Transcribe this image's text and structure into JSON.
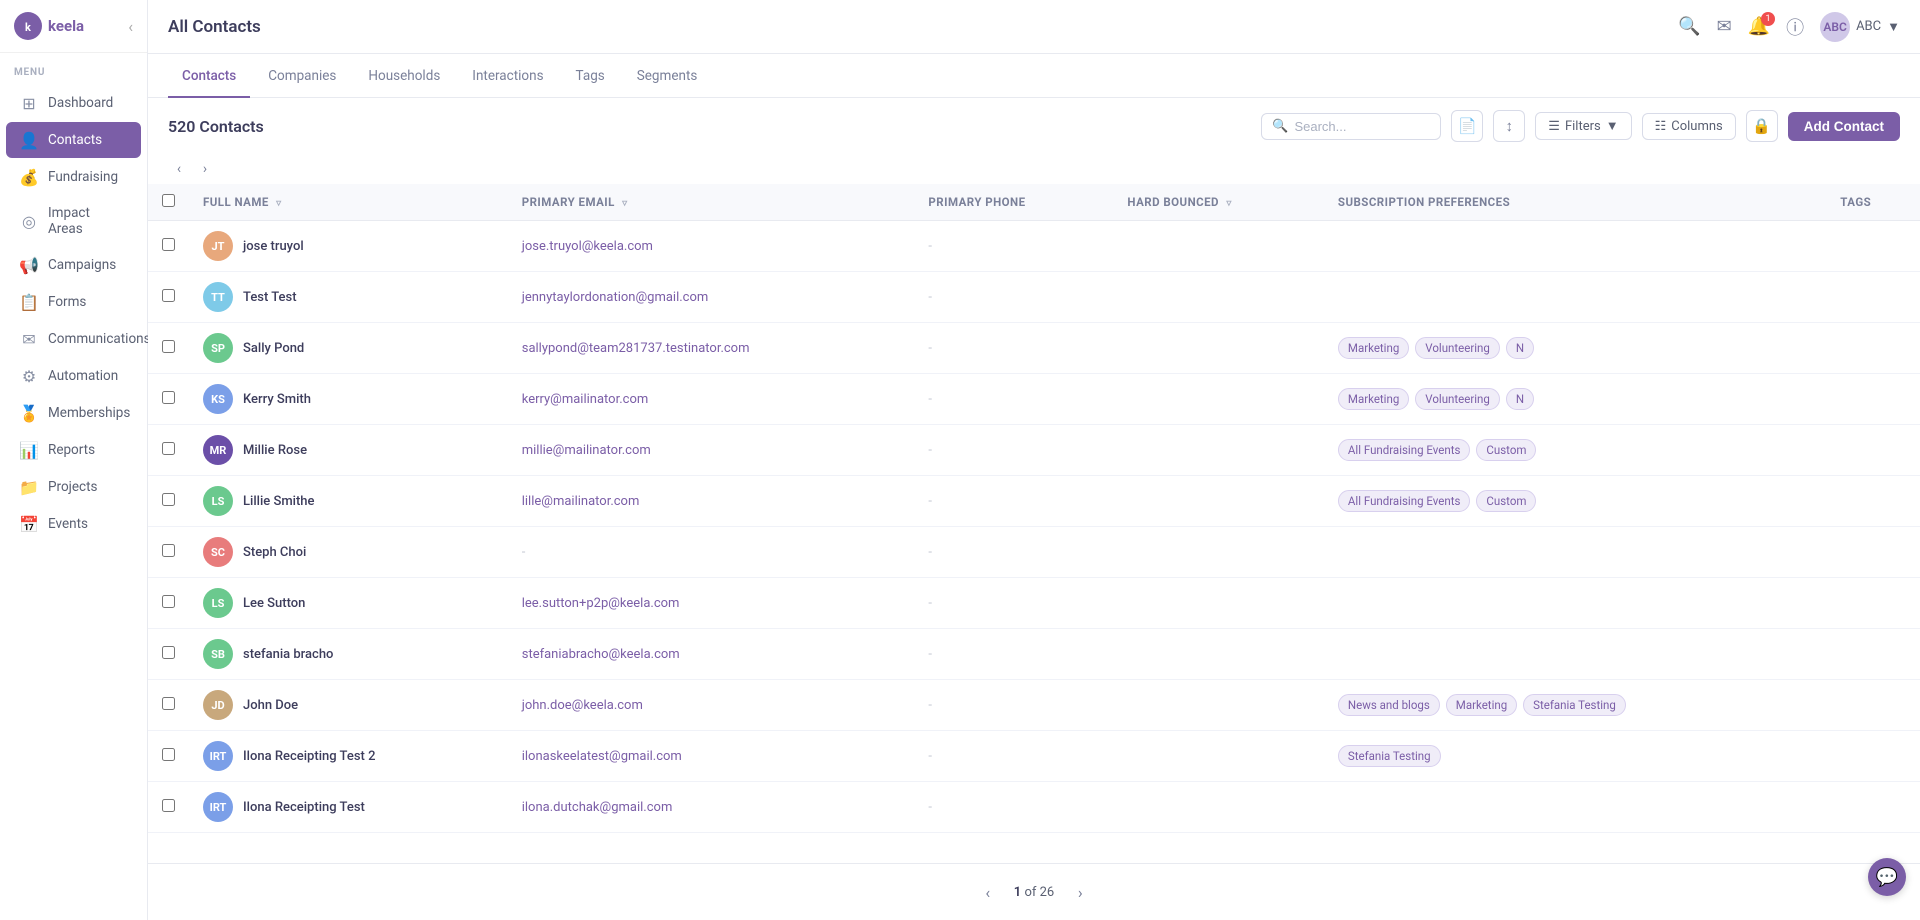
{
  "app": {
    "name": "keela",
    "title": "All Contacts"
  },
  "header": {
    "user_initials": "ABC"
  },
  "sidebar": {
    "menu_label": "MENU",
    "items": [
      {
        "id": "dashboard",
        "label": "Dashboard",
        "icon": "⊞"
      },
      {
        "id": "contacts",
        "label": "Contacts",
        "icon": "👤",
        "active": true
      },
      {
        "id": "fundraising",
        "label": "Fundraising",
        "icon": "💰"
      },
      {
        "id": "impact-areas",
        "label": "Impact Areas",
        "icon": "◎"
      },
      {
        "id": "campaigns",
        "label": "Campaigns",
        "icon": "📢"
      },
      {
        "id": "forms",
        "label": "Forms",
        "icon": "📋"
      },
      {
        "id": "communications",
        "label": "Communications",
        "icon": "✉"
      },
      {
        "id": "automation",
        "label": "Automation",
        "icon": "⚙"
      },
      {
        "id": "memberships",
        "label": "Memberships",
        "icon": "🏅"
      },
      {
        "id": "reports",
        "label": "Reports",
        "icon": "📊"
      },
      {
        "id": "projects",
        "label": "Projects",
        "icon": "📁"
      },
      {
        "id": "events",
        "label": "Events",
        "icon": "📅"
      }
    ]
  },
  "tabs": [
    {
      "id": "contacts",
      "label": "Contacts",
      "active": true
    },
    {
      "id": "companies",
      "label": "Companies",
      "active": false
    },
    {
      "id": "households",
      "label": "Households",
      "active": false
    },
    {
      "id": "interactions",
      "label": "Interactions",
      "active": false
    },
    {
      "id": "tags",
      "label": "Tags",
      "active": false
    },
    {
      "id": "segments",
      "label": "Segments",
      "active": false
    }
  ],
  "toolbar": {
    "contacts_count": "520 Contacts",
    "search_placeholder": "Search...",
    "filters_label": "Filters",
    "columns_label": "Columns",
    "add_contact_label": "Add Contact"
  },
  "table": {
    "columns": [
      {
        "id": "full_name",
        "label": "FULL NAME",
        "sortable": true
      },
      {
        "id": "primary_email",
        "label": "PRIMARY EMAIL",
        "sortable": true
      },
      {
        "id": "primary_phone",
        "label": "PRIMARY PHONE",
        "sortable": false
      },
      {
        "id": "hard_bounced",
        "label": "HARD BOUNCED",
        "sortable": true
      },
      {
        "id": "subscription_preferences",
        "label": "SUBSCRIPTION PREFERENCES",
        "sortable": false
      },
      {
        "id": "tags",
        "label": "TAGS",
        "sortable": false
      }
    ],
    "rows": [
      {
        "id": 1,
        "initials": "JT",
        "avatar_color": "#e8a87c",
        "name": "jose truyol",
        "email": "jose.truyol@keela.com",
        "phone": "-",
        "hard_bounced": "",
        "subscription_tags": [],
        "tags": []
      },
      {
        "id": 2,
        "initials": "TT",
        "avatar_color": "#7ecae8",
        "name": "Test Test",
        "email": "jennytaylordonation@gmail.com",
        "phone": "-",
        "hard_bounced": "",
        "subscription_tags": [],
        "tags": []
      },
      {
        "id": 3,
        "initials": "SP",
        "avatar_color": "#6bc98e",
        "name": "Sally Pond",
        "email": "sallypond@team281737.testinator.com",
        "phone": "-",
        "hard_bounced": "",
        "subscription_tags": [
          "Marketing",
          "Volunteering",
          "N"
        ],
        "tags": []
      },
      {
        "id": 4,
        "initials": "KS",
        "avatar_color": "#7b9fe8",
        "name": "Kerry Smith",
        "email": "kerry@mailinator.com",
        "phone": "-",
        "hard_bounced": "",
        "subscription_tags": [
          "Marketing",
          "Volunteering",
          "N"
        ],
        "tags": []
      },
      {
        "id": 5,
        "initials": "MR",
        "avatar_color": "#6b4fa8",
        "name": "Millie Rose",
        "email": "millie@mailinator.com",
        "phone": "-",
        "hard_bounced": "",
        "subscription_tags": [
          "All Fundraising Events",
          "Custom"
        ],
        "tags": []
      },
      {
        "id": 6,
        "initials": "LS",
        "avatar_color": "#6bc98e",
        "name": "Lillie Smithe",
        "email": "lille@mailinator.com",
        "phone": "-",
        "hard_bounced": "",
        "subscription_tags": [
          "All Fundraising Events",
          "Custom"
        ],
        "tags": []
      },
      {
        "id": 7,
        "initials": "SC",
        "avatar_color": "#e87c7c",
        "name": "Steph Choi",
        "email": "",
        "phone": "-",
        "hard_bounced": "",
        "subscription_tags": [],
        "tags": []
      },
      {
        "id": 8,
        "initials": "LS",
        "avatar_color": "#6bc98e",
        "name": "Lee Sutton",
        "email": "lee.sutton+p2p@keela.com",
        "phone": "-",
        "hard_bounced": "",
        "subscription_tags": [],
        "tags": []
      },
      {
        "id": 9,
        "initials": "SB",
        "avatar_color": "#6bc98e",
        "name": "stefania bracho",
        "email": "stefaniabracho@keela.com",
        "phone": "-",
        "hard_bounced": "",
        "subscription_tags": [],
        "tags": []
      },
      {
        "id": 10,
        "initials": "JD",
        "avatar_color": "#c8a87c",
        "name": "John Doe",
        "email": "john.doe@keela.com",
        "phone": "-",
        "hard_bounced": "",
        "subscription_tags": [
          "News and blogs",
          "Marketing",
          "Stefania Testing"
        ],
        "tags": []
      },
      {
        "id": 11,
        "initials": "IRT",
        "avatar_color": "#7b9fe8",
        "name": "Ilona Receipting Test 2",
        "email": "ilonaskeelatest@gmail.com",
        "phone": "-",
        "hard_bounced": "",
        "subscription_tags": [
          "Stefania Testing"
        ],
        "tags": []
      },
      {
        "id": 12,
        "initials": "IRT",
        "avatar_color": "#7b9fe8",
        "name": "Ilona Receipting Test",
        "email": "ilona.dutchak@gmail.com",
        "phone": "-",
        "hard_bounced": "",
        "subscription_tags": [],
        "tags": []
      }
    ]
  },
  "pagination": {
    "current_page": 1,
    "total_pages": 26,
    "of_label": "of"
  }
}
